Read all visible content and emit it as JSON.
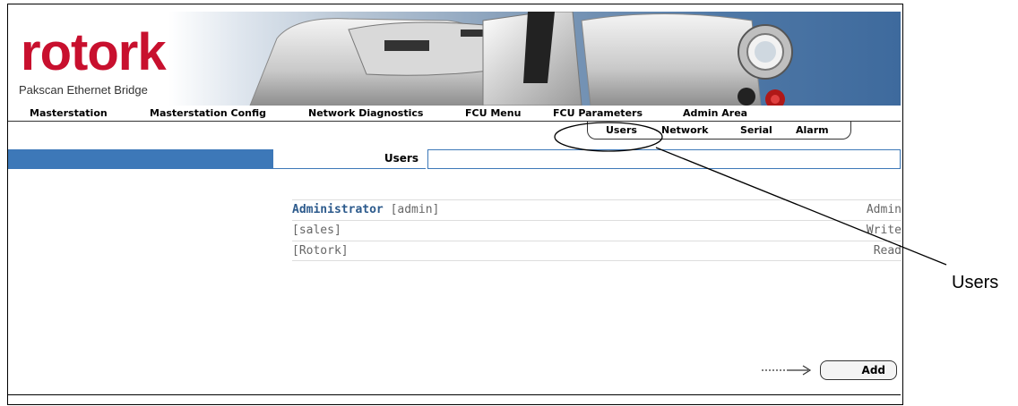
{
  "brand": {
    "logo_text": "rotork",
    "tagline": "Pakscan Ethernet Bridge",
    "logo_color": "#c8102e"
  },
  "main_nav": [
    {
      "label": "Masterstation"
    },
    {
      "label": "Masterstation Config"
    },
    {
      "label": "Network Diagnostics"
    },
    {
      "label": "FCU Menu"
    },
    {
      "label": "FCU Parameters"
    },
    {
      "label": "Admin Area"
    }
  ],
  "sub_nav": [
    {
      "label": "Users"
    },
    {
      "label": "Network"
    },
    {
      "label": "Serial"
    },
    {
      "label": "Alarm"
    }
  ],
  "page": {
    "title": "Users",
    "accent_color": "#3d78b8"
  },
  "users": [
    {
      "name": "Administrator",
      "login": "[admin]",
      "role": "Admin"
    },
    {
      "name": "",
      "login": "[sales]",
      "role": "Write"
    },
    {
      "name": "",
      "login": "[Rotork]",
      "role": "Read"
    }
  ],
  "actions": {
    "add_label": "Add"
  },
  "annotation": {
    "label": "Users"
  }
}
